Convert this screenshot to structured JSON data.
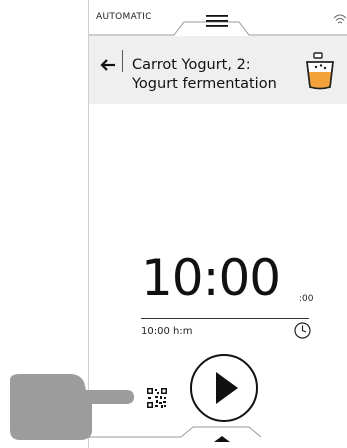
{
  "topbar": {
    "mode_label": "AUTOMATIC",
    "menu_icon": "hamburger-menu-icon",
    "wifi_icon": "wifi-icon"
  },
  "header": {
    "back_icon": "arrow-left-icon",
    "recipe_title_line1": "Carrot Yogurt, 2:",
    "recipe_title_line2": "Yogurt fermentation",
    "recipe_icon": "yogurt-jar-icon"
  },
  "timer": {
    "main": "10:00",
    "seconds": ":00",
    "unit_label": "10:00 h:m",
    "clock_icon": "clock-icon"
  },
  "controls": {
    "play_icon": "play-icon",
    "qr_icon": "qr-code-icon"
  },
  "bottombar": {
    "chevron_icon": "chevron-up-icon"
  },
  "overlay": {
    "hand_icon": "pointing-hand-icon"
  },
  "colors": {
    "header_bg": "#efefef",
    "accent_orange": "#f2a23a",
    "text": "#111111"
  }
}
